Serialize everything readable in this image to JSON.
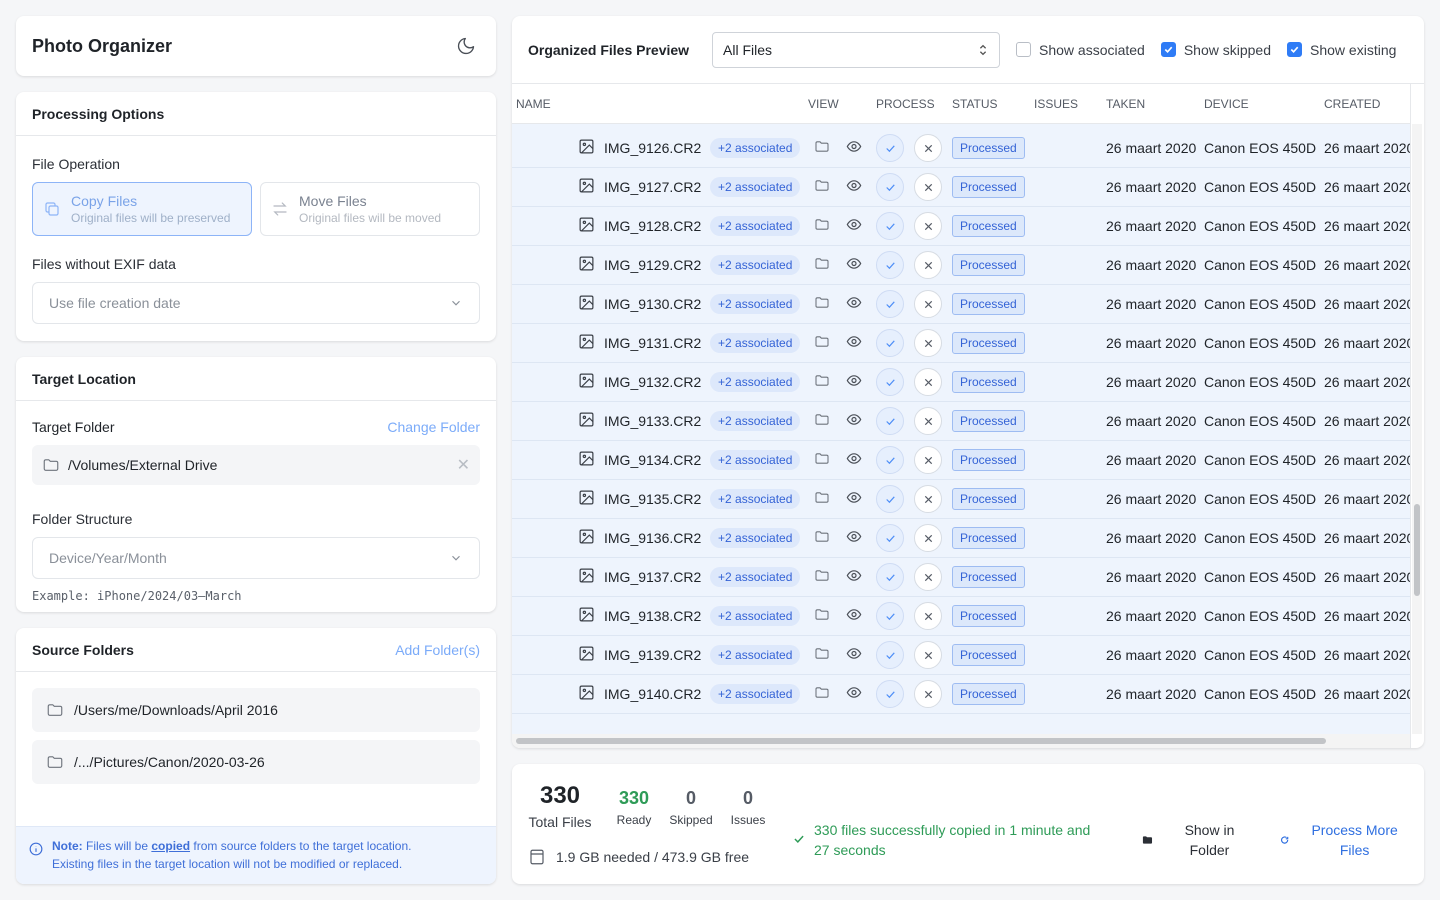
{
  "app": {
    "title": "Photo Organizer"
  },
  "processing": {
    "title": "Processing Options",
    "file_operation_label": "File Operation",
    "copy": {
      "title": "Copy Files",
      "desc": "Original files will be preserved",
      "selected": true
    },
    "move": {
      "title": "Move Files",
      "desc": "Original files will be moved",
      "selected": false
    },
    "no_exif_label": "Files without EXIF data",
    "no_exif_value": "Use file creation date"
  },
  "target": {
    "title": "Target Location",
    "folder_label": "Target Folder",
    "change_folder": "Change Folder",
    "path": "/Volumes/External Drive",
    "structure_label": "Folder Structure",
    "structure_value": "Device/Year/Month",
    "example": "Example: iPhone/2024/03–March"
  },
  "source": {
    "title": "Source Folders",
    "add": "Add Folder(s)",
    "folders": [
      "/Users/me/Downloads/April 2016",
      "/.../Pictures/Canon/2020-03-26"
    ],
    "note_prefix": "Note:",
    "note_text1": " Files will be ",
    "note_copied": "copied",
    "note_text2": " from source folders to the target location.",
    "note_line2": "Existing files in the target location will not be modified or replaced."
  },
  "preview": {
    "title": "Organized Files Preview",
    "filter": "All Files",
    "checks": [
      {
        "label": "Show associated",
        "checked": false
      },
      {
        "label": "Show skipped",
        "checked": true
      },
      {
        "label": "Show existing",
        "checked": true
      }
    ],
    "columns": [
      "NAME",
      "VIEW",
      "PROCESS",
      "STATUS",
      "ISSUES",
      "TAKEN",
      "DEVICE",
      "CREATED"
    ],
    "rows": [
      {
        "name": "IMG_9126.CR2",
        "badge": "+2 associated",
        "status": "Processed",
        "taken": "26 maart 2020",
        "device": "Canon EOS 450D",
        "created": "26 maart 2020"
      },
      {
        "name": "IMG_9127.CR2",
        "badge": "+2 associated",
        "status": "Processed",
        "taken": "26 maart 2020",
        "device": "Canon EOS 450D",
        "created": "26 maart 2020"
      },
      {
        "name": "IMG_9128.CR2",
        "badge": "+2 associated",
        "status": "Processed",
        "taken": "26 maart 2020",
        "device": "Canon EOS 450D",
        "created": "26 maart 2020"
      },
      {
        "name": "IMG_9129.CR2",
        "badge": "+2 associated",
        "status": "Processed",
        "taken": "26 maart 2020",
        "device": "Canon EOS 450D",
        "created": "26 maart 2020"
      },
      {
        "name": "IMG_9130.CR2",
        "badge": "+2 associated",
        "status": "Processed",
        "taken": "26 maart 2020",
        "device": "Canon EOS 450D",
        "created": "26 maart 2020"
      },
      {
        "name": "IMG_9131.CR2",
        "badge": "+2 associated",
        "status": "Processed",
        "taken": "26 maart 2020",
        "device": "Canon EOS 450D",
        "created": "26 maart 2020"
      },
      {
        "name": "IMG_9132.CR2",
        "badge": "+2 associated",
        "status": "Processed",
        "taken": "26 maart 2020",
        "device": "Canon EOS 450D",
        "created": "26 maart 2020"
      },
      {
        "name": "IMG_9133.CR2",
        "badge": "+2 associated",
        "status": "Processed",
        "taken": "26 maart 2020",
        "device": "Canon EOS 450D",
        "created": "26 maart 2020"
      },
      {
        "name": "IMG_9134.CR2",
        "badge": "+2 associated",
        "status": "Processed",
        "taken": "26 maart 2020",
        "device": "Canon EOS 450D",
        "created": "26 maart 2020"
      },
      {
        "name": "IMG_9135.CR2",
        "badge": "+2 associated",
        "status": "Processed",
        "taken": "26 maart 2020",
        "device": "Canon EOS 450D",
        "created": "26 maart 2020"
      },
      {
        "name": "IMG_9136.CR2",
        "badge": "+2 associated",
        "status": "Processed",
        "taken": "26 maart 2020",
        "device": "Canon EOS 450D",
        "created": "26 maart 2020"
      },
      {
        "name": "IMG_9137.CR2",
        "badge": "+2 associated",
        "status": "Processed",
        "taken": "26 maart 2020",
        "device": "Canon EOS 450D",
        "created": "26 maart 2020"
      },
      {
        "name": "IMG_9138.CR2",
        "badge": "+2 associated",
        "status": "Processed",
        "taken": "26 maart 2020",
        "device": "Canon EOS 450D",
        "created": "26 maart 2020"
      },
      {
        "name": "IMG_9139.CR2",
        "badge": "+2 associated",
        "status": "Processed",
        "taken": "26 maart 2020",
        "device": "Canon EOS 450D",
        "created": "26 maart 2020"
      },
      {
        "name": "IMG_9140.CR2",
        "badge": "+2 associated",
        "status": "Processed",
        "taken": "26 maart 2020",
        "device": "Canon EOS 450D",
        "created": "26 maart 2020"
      }
    ]
  },
  "stats": {
    "total": {
      "value": "330",
      "label": "Total Files"
    },
    "ready": {
      "value": "330",
      "label": "Ready"
    },
    "skipped": {
      "value": "0",
      "label": "Skipped"
    },
    "issues": {
      "value": "0",
      "label": "Issues"
    },
    "disk": "1.9 GB needed / 473.9 GB free",
    "success": "330 files successfully copied in 1 minute and 27 seconds",
    "show_in_folder": "Show in Folder",
    "process_more": "Process More Files"
  },
  "colors": {
    "accent": "#2f7cf6",
    "success": "#2e9b57",
    "row_bg": "#eef4fd"
  }
}
